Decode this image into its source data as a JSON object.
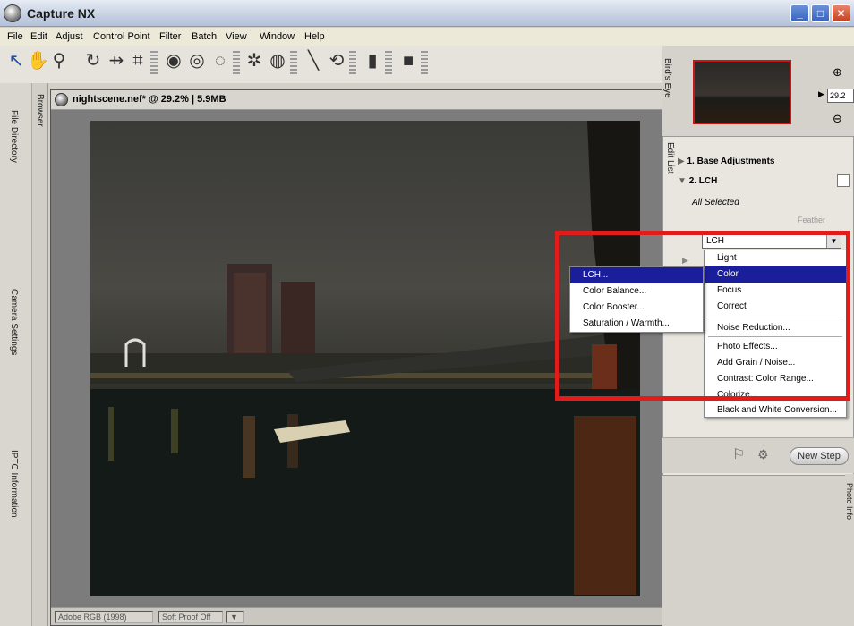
{
  "app": {
    "title": "Capture NX"
  },
  "menu": [
    "File",
    "Edit",
    "Adjust",
    "Control Point",
    "Filter",
    "Batch",
    "View",
    "Window",
    "Help"
  ],
  "left_tabs": [
    "File Directory",
    "Camera Settings",
    "IPTC Information"
  ],
  "browser_tab": "Browser",
  "document": {
    "title": "nightscene.nef* @ 29.2% | 5.9MB",
    "status_profile": "Adobe RGB (1998)",
    "status_softproof": "Soft Proof Off"
  },
  "right": {
    "birds_eye_tab": "Bird's Eye",
    "edit_list_tab": "Edit List",
    "zoom_value": "29.2",
    "zoom_unit": "%",
    "step1": "1. Base Adjustments",
    "step2": "2. LCH",
    "selection": "All Selected",
    "feather": "Feather",
    "new_step": "New Step",
    "photo_info_tab": "Photo Info"
  },
  "dropdown": {
    "value": "LCH"
  },
  "category_menu": {
    "items": [
      "Light",
      "Color",
      "Focus",
      "Correct",
      "Noise Reduction...",
      "Photo Effects...",
      "Add Grain / Noise...",
      "Contrast: Color Range...",
      "Colorize...",
      "Black and White Conversion..."
    ],
    "selected": "Color"
  },
  "color_submenu": {
    "items": [
      "LCH...",
      "Color Balance...",
      "Color Booster...",
      "Saturation / Warmth..."
    ],
    "selected": "LCH..."
  },
  "colors": {
    "highlight": "#e21b1b",
    "menu_select": "#1a1e9a"
  }
}
